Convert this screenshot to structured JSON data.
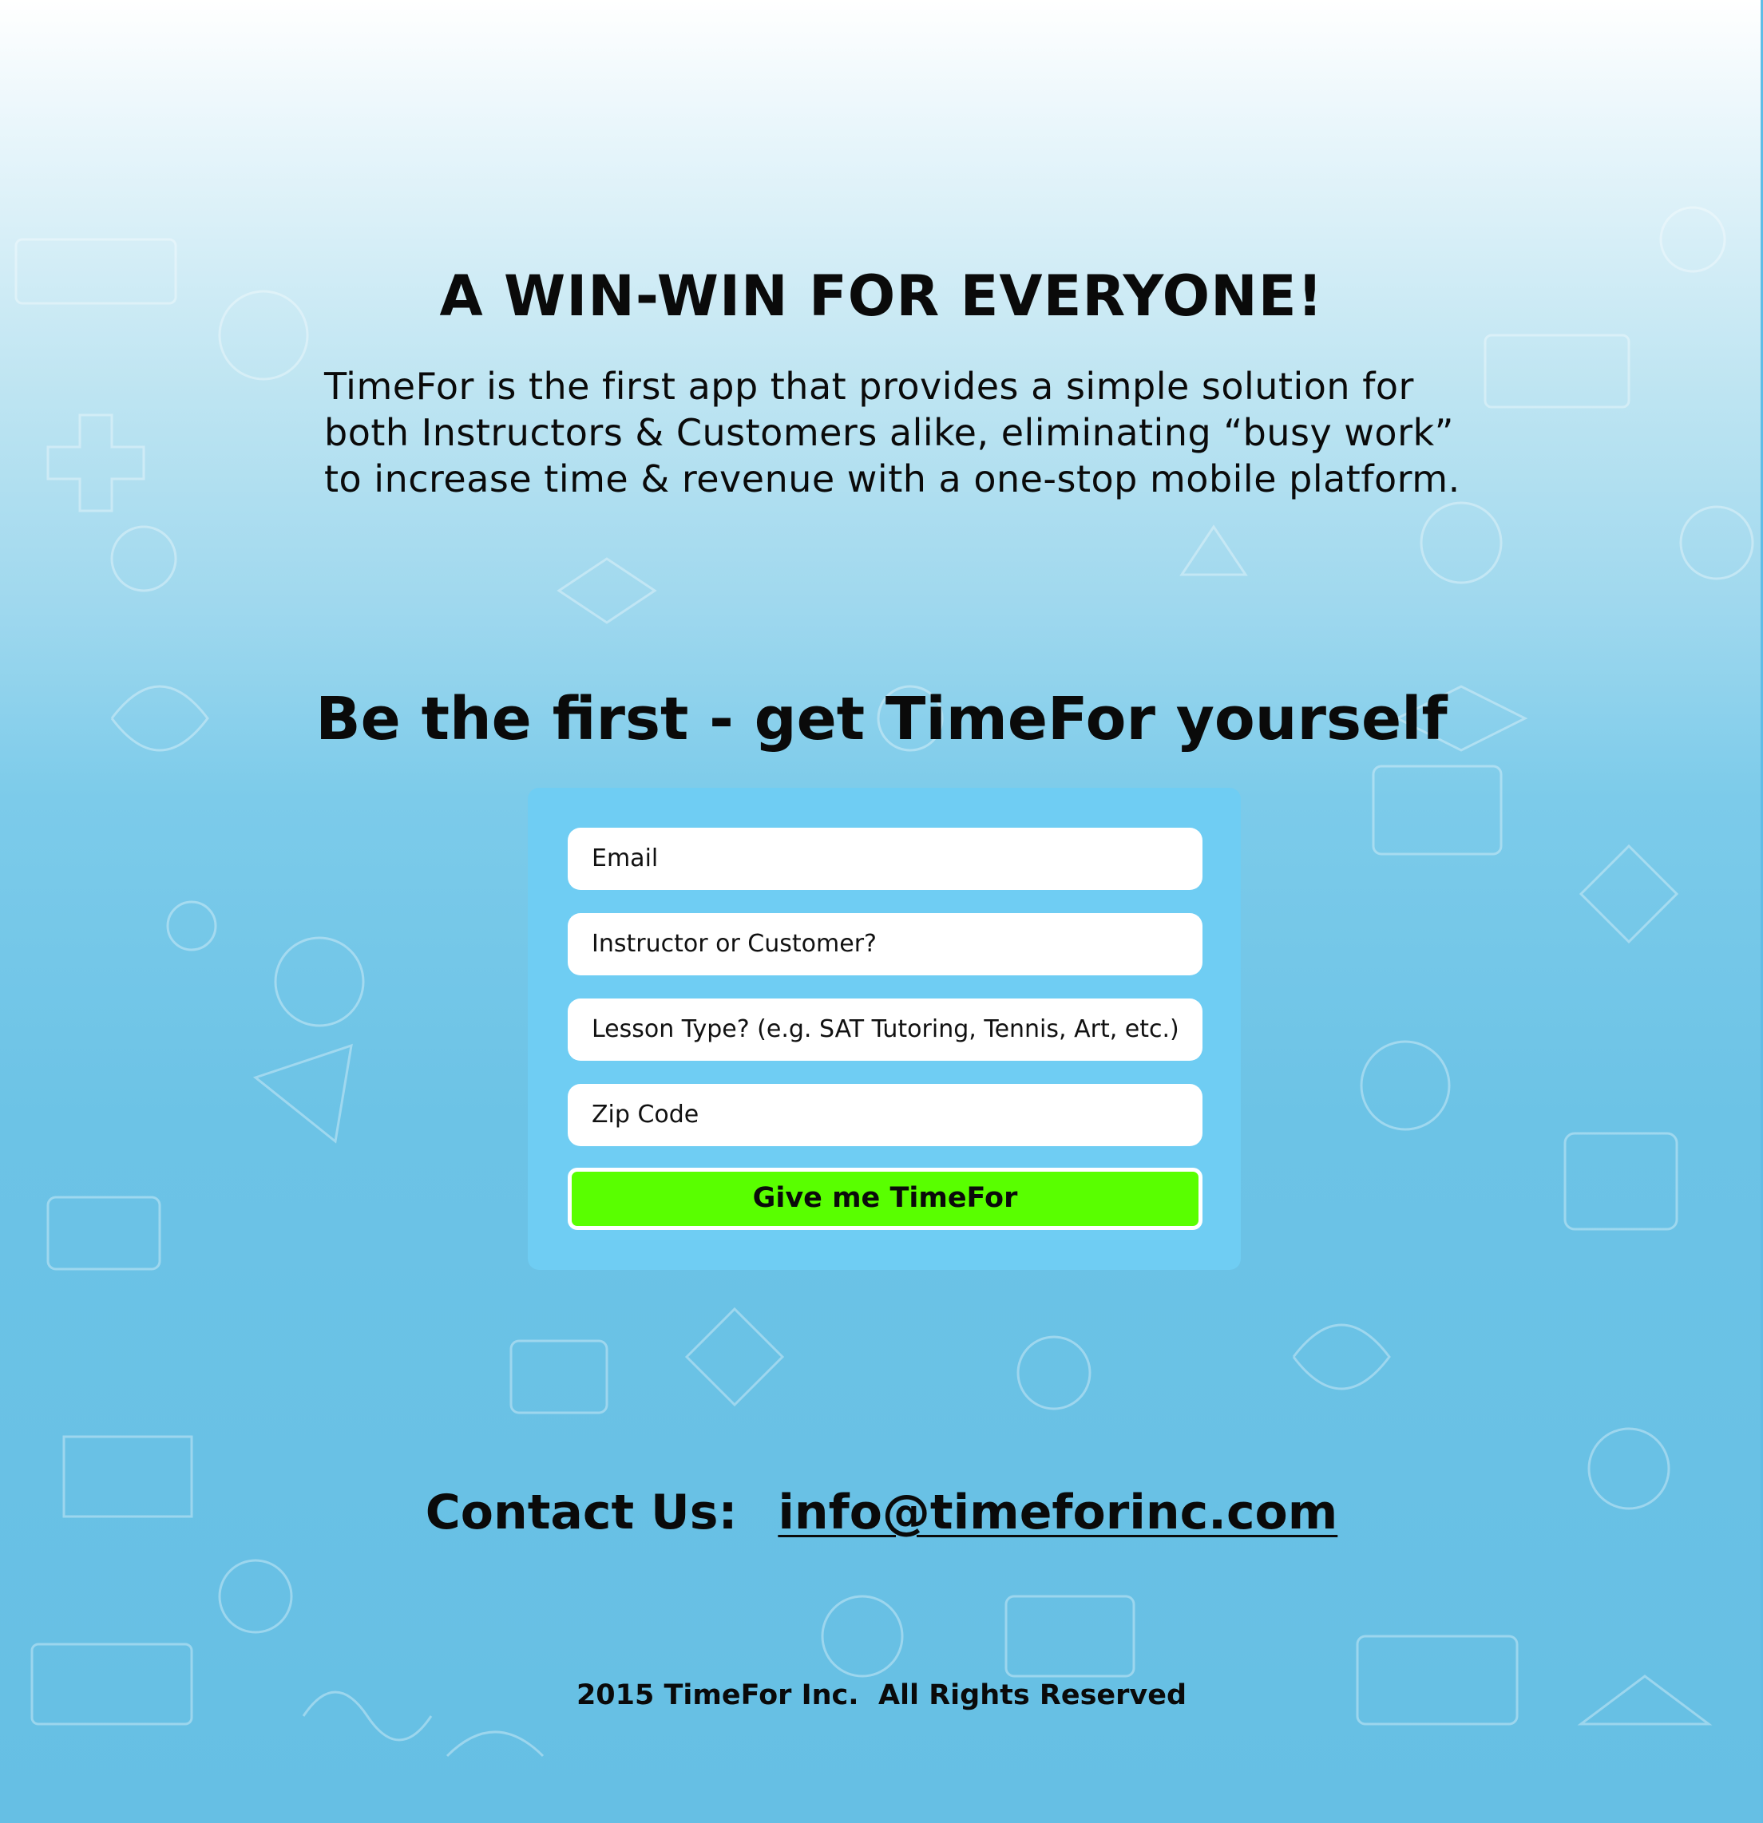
{
  "headline": "A WIN-WIN FOR EVERYONE!",
  "intro": {
    "lines": [
      "TimeFor is the first app that provides a simple solution for",
      "both Instructors & Customers alike, eliminating “busy work”",
      "to increase time & revenue with a one-stop mobile platform."
    ]
  },
  "signup": {
    "title": "Be the first - get TimeFor yourself",
    "fields": {
      "email": "Email",
      "role": "Instructor or Customer?",
      "lesson_type": "Lesson Type?  (e.g. SAT Tutoring, Tennis, Art, etc.)",
      "zip": "Zip Code"
    },
    "submit_label": "Give me TimeFor"
  },
  "contact": {
    "label": "Contact Us:",
    "email": "info@timeforinc.com"
  },
  "footer": "2015 TimeFor Inc.  All Rights Reserved",
  "colors": {
    "form_panel": "#6fcdf3",
    "submit_button": "#59ff00",
    "background_bottom": "#66bfe4"
  }
}
